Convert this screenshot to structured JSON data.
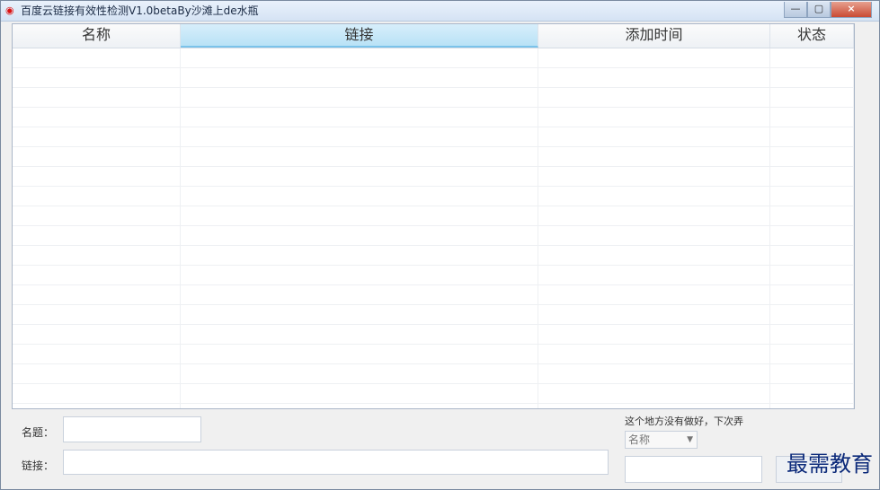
{
  "window": {
    "title": "百度云链接有效性检测V1.0betaBy沙滩上de水瓶",
    "app_icon": "app-logo-icon",
    "controls": {
      "minimize": "minimize-icon",
      "maximize": "maximize-icon",
      "close": "close-icon"
    }
  },
  "table": {
    "columns": [
      "名称",
      "链接",
      "添加时间",
      "状态"
    ],
    "active_column": 1,
    "rows": []
  },
  "form": {
    "name_label": "名题：",
    "link_label": "链接：",
    "name_value": "",
    "link_value": "",
    "note": "这个地方没有做好，下次弄",
    "select_value": "名称",
    "search_value": ""
  },
  "watermark": "最需教育",
  "colors": {
    "title_gradient_top": "#e9f1fb",
    "title_gradient_bottom": "#d5e3f4",
    "active_column": "#b9e2f6",
    "close_button": "#c94a34"
  }
}
